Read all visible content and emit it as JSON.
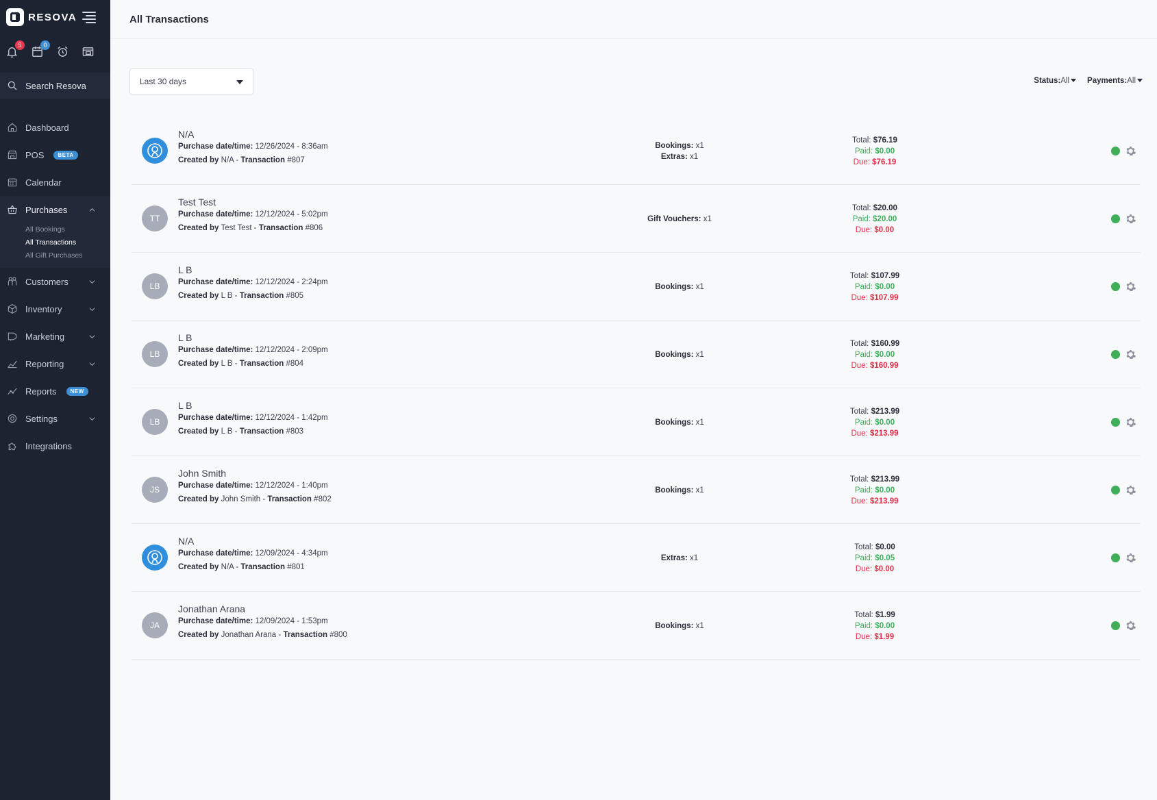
{
  "brand": {
    "name": "RESOVA"
  },
  "quick_icons": [
    {
      "name": "notifications",
      "badge": "5",
      "badge_color": "#e63950"
    },
    {
      "name": "calendar",
      "badge": "0",
      "badge_color": "#3d8fd6"
    },
    {
      "name": "alarm",
      "badge": null
    },
    {
      "name": "window",
      "badge": null
    }
  ],
  "search": {
    "label": "Search Resova"
  },
  "nav": {
    "dashboard": "Dashboard",
    "pos": "POS",
    "pos_badge": "BETA",
    "calendar": "Calendar",
    "purchases": "Purchases",
    "purchases_sub": [
      "All Bookings",
      "All Transactions",
      "All Gift Purchases"
    ],
    "customers": "Customers",
    "inventory": "Inventory",
    "marketing": "Marketing",
    "reporting": "Reporting",
    "reports": "Reports",
    "reports_badge": "NEW",
    "settings": "Settings",
    "integrations": "Integrations"
  },
  "page": {
    "title": "All Transactions"
  },
  "filters": {
    "date_range": "Last 30 days",
    "status_label": "Status:",
    "status_value": "All",
    "payments_label": "Payments:",
    "payments_value": "All"
  },
  "labels": {
    "purchase_dt": "Purchase date/time:",
    "created_by": "Created by",
    "transaction": "Transaction",
    "total": "Total:",
    "paid": "Paid:",
    "due": "Due:"
  },
  "transactions": [
    {
      "avatar": "",
      "avatar_type": "icon",
      "name": "N/A",
      "datetime": "12/26/2024 - 8:36am",
      "creator": "N/A",
      "number": "#807",
      "counts": [
        {
          "label": "Bookings:",
          "value": "x1"
        },
        {
          "label": "Extras:",
          "value": "x1"
        }
      ],
      "total": "$76.19",
      "paid": "$0.00",
      "due": "$76.19"
    },
    {
      "avatar": "TT",
      "avatar_type": "initials",
      "name": "Test Test",
      "datetime": "12/12/2024 - 5:02pm",
      "creator": "Test Test",
      "number": "#806",
      "counts": [
        {
          "label": "Gift Vouchers:",
          "value": "x1"
        }
      ],
      "total": "$20.00",
      "paid": "$20.00",
      "due": "$0.00"
    },
    {
      "avatar": "LB",
      "avatar_type": "initials",
      "name": "L B",
      "datetime": "12/12/2024 - 2:24pm",
      "creator": "L B",
      "number": "#805",
      "counts": [
        {
          "label": "Bookings:",
          "value": "x1"
        }
      ],
      "total": "$107.99",
      "paid": "$0.00",
      "due": "$107.99"
    },
    {
      "avatar": "LB",
      "avatar_type": "initials",
      "name": "L B",
      "datetime": "12/12/2024 - 2:09pm",
      "creator": "L B",
      "number": "#804",
      "counts": [
        {
          "label": "Bookings:",
          "value": "x1"
        }
      ],
      "total": "$160.99",
      "paid": "$0.00",
      "due": "$160.99"
    },
    {
      "avatar": "LB",
      "avatar_type": "initials",
      "name": "L B",
      "datetime": "12/12/2024 - 1:42pm",
      "creator": "L B",
      "number": "#803",
      "counts": [
        {
          "label": "Bookings:",
          "value": "x1"
        }
      ],
      "total": "$213.99",
      "paid": "$0.00",
      "due": "$213.99"
    },
    {
      "avatar": "JS",
      "avatar_type": "initials",
      "name": "John Smith",
      "datetime": "12/12/2024 - 1:40pm",
      "creator": "John Smith",
      "number": "#802",
      "counts": [
        {
          "label": "Bookings:",
          "value": "x1"
        }
      ],
      "total": "$213.99",
      "paid": "$0.00",
      "due": "$213.99"
    },
    {
      "avatar": "",
      "avatar_type": "icon",
      "name": "N/A",
      "datetime": "12/09/2024 - 4:34pm",
      "creator": "N/A",
      "number": "#801",
      "counts": [
        {
          "label": "Extras:",
          "value": "x1"
        }
      ],
      "total": "$0.00",
      "paid": "$0.05",
      "due": "$0.00"
    },
    {
      "avatar": "JA",
      "avatar_type": "initials",
      "name": "Jonathan Arana",
      "datetime": "12/09/2024 - 1:53pm",
      "creator": "Jonathan Arana",
      "number": "#800",
      "counts": [
        {
          "label": "Bookings:",
          "value": "x1"
        }
      ],
      "total": "$1.99",
      "paid": "$0.00",
      "due": "$1.99"
    }
  ],
  "colors": {
    "sidebar": "#1c2331",
    "paid": "#3bae5a",
    "due": "#e12d45",
    "status_ok": "#3fae59",
    "accent": "#2f8fdc"
  }
}
